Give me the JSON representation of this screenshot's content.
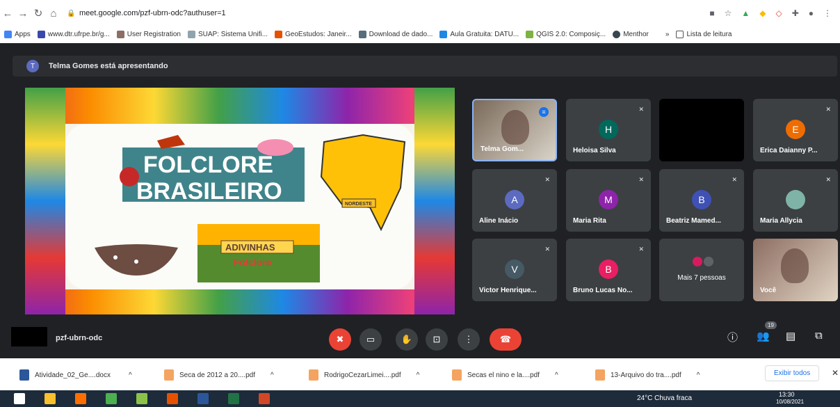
{
  "browser": {
    "url": "meet.google.com/pzf-ubrn-odc?authuser=1"
  },
  "bookmarks": [
    "Apps",
    "www.dtr.ufrpe.br/g...",
    "User Registration",
    "SUAP: Sistema Unifi...",
    "GeoEstudos: Janeir...",
    "Download de dado...",
    "Aula Gratuita: DATU...",
    "QGIS 2.0: Composiç...",
    "Menthor",
    "»",
    "Lista de leitura"
  ],
  "banner": {
    "initial": "T",
    "text": "Telma Gomes está apresentando"
  },
  "slide": {
    "title1": "FOLCLORE",
    "title2": "BRASILEIRO",
    "map_label": "NORDESTE",
    "inset1": "ADIVINHAS",
    "inset2": "Folclore"
  },
  "participants": [
    {
      "name": "Telma Gom...",
      "initial": "",
      "color": "",
      "video": true
    },
    {
      "name": "Heloisa Silva",
      "initial": "H",
      "color": "#00695c"
    },
    {
      "name": "",
      "initial": "",
      "color": "",
      "black": true
    },
    {
      "name": "Erica Daianny P...",
      "initial": "E",
      "color": "#ef6c00"
    },
    {
      "name": "Aline Inácio",
      "initial": "A",
      "color": "#5c6bc0"
    },
    {
      "name": "Maria Rita",
      "initial": "M",
      "color": "#8e24aa"
    },
    {
      "name": "Beatriz Mamed...",
      "initial": "B",
      "color": "#3f51b5"
    },
    {
      "name": "Maria Allycia",
      "initial": "",
      "color": ""
    },
    {
      "name": "Victor Henrique...",
      "initial": "V",
      "color": "#455a64"
    },
    {
      "name": "Bruno Lucas No...",
      "initial": "B",
      "color": "#e91e63"
    },
    {
      "name": "Mais 7 pessoas",
      "initial": "",
      "color": ""
    },
    {
      "name": "Você",
      "initial": "",
      "color": "",
      "video": true
    }
  ],
  "meeting": {
    "code": "pzf-ubrn-odc",
    "people_count": "19"
  },
  "downloads": [
    "Atividade_02_Ge....docx",
    "Seca de 2012 a 20....pdf",
    "RodrigoCezarLimei....pdf",
    "Secas el nino e la....pdf",
    "13-Arquivo do tra....pdf"
  ],
  "download_show_all": "Exibir todos",
  "taskbar": {
    "weather": "24°C  Chuva fraca",
    "time": "13:30",
    "date": "10/08/2021"
  }
}
